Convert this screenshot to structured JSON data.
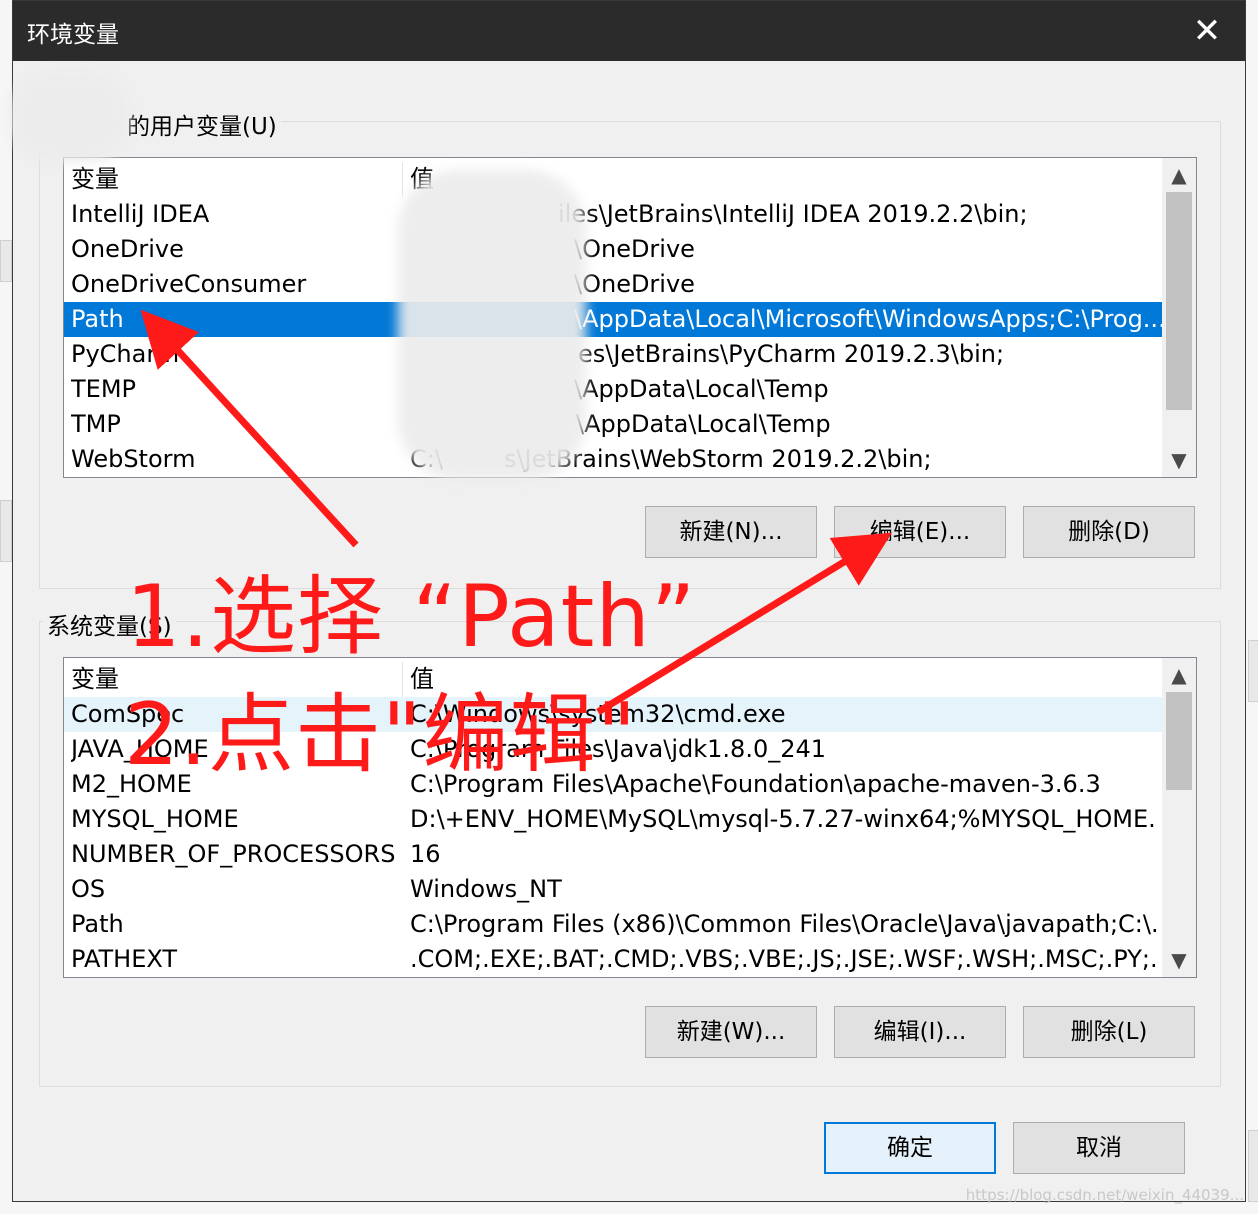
{
  "dialog": {
    "title": "环境变量",
    "close_glyph": "✕"
  },
  "user_vars": {
    "label": "的用户变量(U)",
    "columns": [
      "变量",
      "值"
    ],
    "rows": [
      {
        "name": "IntelliJ IDEA",
        "value": "iles\\JetBrains\\IntelliJ IDEA 2019.2.2\\bin;"
      },
      {
        "name": "OneDrive",
        "value": "\\OneDrive"
      },
      {
        "name": "OneDriveConsumer",
        "value": "\\OneDrive"
      },
      {
        "name": "Path",
        "value": "\\AppData\\Local\\Microsoft\\WindowsApps;C:\\Prog..."
      },
      {
        "name": "PyCharm",
        "value": "es\\JetBrains\\PyCharm 2019.2.3\\bin;"
      },
      {
        "name": "TEMP",
        "value": "\\AppData\\Local\\Temp"
      },
      {
        "name": "TMP",
        "value": "\\AppData\\Local\\Temp"
      },
      {
        "name": "WebStorm",
        "value": "C:\\        s\\JetBrains\\WebStorm 2019.2.2\\bin;"
      }
    ],
    "selected_index": 3,
    "buttons": {
      "new": "新建(N)...",
      "edit": "编辑(E)...",
      "delete": "删除(D)"
    }
  },
  "system_vars": {
    "label": "系统变量(S)",
    "columns": [
      "变量",
      "值"
    ],
    "rows": [
      {
        "name": "ComSpec",
        "value": "C:\\Windows\\system32\\cmd.exe"
      },
      {
        "name": "JAVA_HOME",
        "value": "C:\\Program Files\\Java\\jdk1.8.0_241"
      },
      {
        "name": "M2_HOME",
        "value": "C:\\Program Files\\Apache\\Foundation\\apache-maven-3.6.3"
      },
      {
        "name": "MYSQL_HOME",
        "value": "D:\\+ENV_HOME\\MySQL\\mysql-5.7.27-winx64;%MYSQL_HOME..."
      },
      {
        "name": "NUMBER_OF_PROCESSORS",
        "value": "16"
      },
      {
        "name": "OS",
        "value": "Windows_NT"
      },
      {
        "name": "Path",
        "value": "C:\\Program Files (x86)\\Common Files\\Oracle\\Java\\javapath;C:\\..."
      },
      {
        "name": "PATHEXT",
        "value": ".COM;.EXE;.BAT;.CMD;.VBS;.VBE;.JS;.JSE;.WSF;.WSH;.MSC;.PY;.PY..."
      }
    ],
    "buttons": {
      "new": "新建(W)...",
      "edit": "编辑(I)...",
      "delete": "删除(L)"
    }
  },
  "footer": {
    "ok": "确定",
    "cancel": "取消"
  },
  "annotations": {
    "step1": "1.选择 “Path”",
    "step2": "2.点击\"编辑\"",
    "color": "#ff1a1a"
  },
  "watermark": "https://blog.csdn.net/weixin_44039..."
}
